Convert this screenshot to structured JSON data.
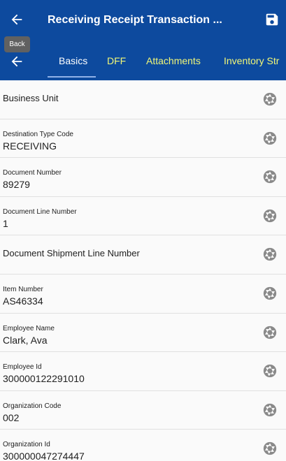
{
  "header": {
    "title": "Receiving Receipt Transaction ...",
    "back_tooltip": "Back"
  },
  "tabs": [
    {
      "label": "Basics"
    },
    {
      "label": "DFF"
    },
    {
      "label": "Attachments"
    },
    {
      "label": "Inventory Str"
    }
  ],
  "fields": [
    {
      "label": "Business Unit",
      "value": ""
    },
    {
      "label": "Destination Type Code",
      "value": "RECEIVING"
    },
    {
      "label": "Document Number",
      "value": "89279"
    },
    {
      "label": "Document Line Number",
      "value": "1"
    },
    {
      "label": "Document Shipment Line Number",
      "value": ""
    },
    {
      "label": "Item Number",
      "value": "AS46334"
    },
    {
      "label": "Employee Name",
      "value": "Clark, Ava"
    },
    {
      "label": "Employee Id",
      "value": "300000122291010"
    },
    {
      "label": "Organization Code",
      "value": "002"
    },
    {
      "label": "Organization Id",
      "value": "300000047274447"
    }
  ],
  "colors": {
    "header_bg": "#0d4a9e",
    "active_tab": "#ffffff",
    "inactive_tab": "#f1f777",
    "icon_gray": "#8a8a8a"
  },
  "icons": {
    "back": "arrow-left-icon",
    "save": "save-icon",
    "lov": "aperture-icon"
  }
}
